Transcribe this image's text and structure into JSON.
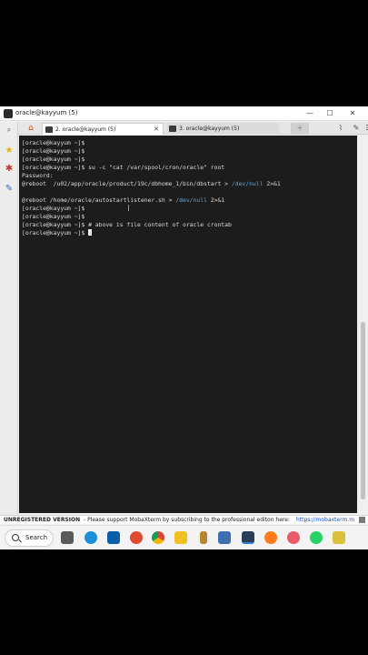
{
  "window": {
    "title": "oracle@kayyum (5)",
    "minimize_glyph": "—",
    "maximize_glyph": "☐",
    "close_glyph": "✕"
  },
  "tabs": [
    {
      "label": "2. oracle@kayyum (5)",
      "close": "✕",
      "active": true
    },
    {
      "label": "3. oracle@kayyum (5)",
      "active": false
    }
  ],
  "terminal": {
    "lines": [
      {
        "text": "[oracle@kayyum ~]$"
      },
      {
        "text": "[oracle@kayyum ~]$"
      },
      {
        "text": "[oracle@kayyum ~]$"
      },
      {
        "text": "[oracle@kayyum ~]$ su -c \"cat /var/spool/cron/oracle\" root"
      },
      {
        "text": "Password:"
      },
      {
        "pre": "@reboot  /u02/app/oracle/product/19c/dbhome_1/bin/dbstart > ",
        "highlight": "/dev/null",
        "post": " 2>&1"
      },
      {
        "text": ""
      },
      {
        "pre": "@reboot /home/oracle/autostartlistener.sh > ",
        "highlight": "/dev/null",
        "post": " 2>&1"
      },
      {
        "text": "[oracle@kayyum ~]$"
      },
      {
        "text": "[oracle@kayyum ~]$"
      },
      {
        "text": "[oracle@kayyum ~]$ # above is file content of oracle crontab"
      },
      {
        "text": "[oracle@kayyum ~]$ ",
        "cursor": true
      }
    ],
    "colors": {
      "background": "#1c1c1c",
      "text": "#dcdcdc",
      "highlight": "#5aa7e0"
    }
  },
  "statusbar": {
    "unregistered": "UNREGISTERED VERSION",
    "message": " -  Please support MobaXterm by subscribing to the professional editon here:",
    "url": "https://mobaxterm.m"
  },
  "taskbar": {
    "search_label": "Search",
    "icons": [
      "task-view-icon",
      "edge-icon",
      "store-icon",
      "app-icon",
      "chrome-icon",
      "file-explorer-icon",
      "tool-icon",
      "mobaxterm-icon",
      "firefox-icon",
      "browser-icon",
      "whatsapp-icon",
      "puzzle-icon"
    ]
  }
}
